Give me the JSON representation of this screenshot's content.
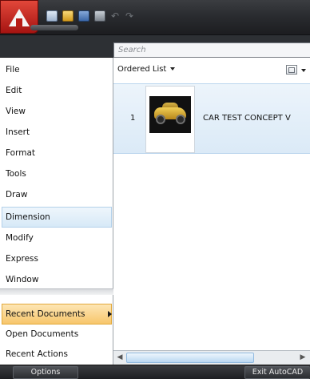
{
  "search": {
    "placeholder": "Search"
  },
  "menu": {
    "items": [
      {
        "label": "File"
      },
      {
        "label": "Edit"
      },
      {
        "label": "View"
      },
      {
        "label": "Insert"
      },
      {
        "label": "Format"
      },
      {
        "label": "Tools"
      },
      {
        "label": "Draw"
      },
      {
        "label": "Dimension"
      },
      {
        "label": "Modify"
      },
      {
        "label": "Express"
      },
      {
        "label": "Window"
      }
    ],
    "lower_items": [
      {
        "label": "Recent Documents"
      },
      {
        "label": "Open Documents"
      },
      {
        "label": "Recent Actions"
      }
    ]
  },
  "list": {
    "sort_label": "Ordered List",
    "documents": [
      {
        "index": "1",
        "name": "CAR TEST CONCEPT V"
      }
    ]
  },
  "footer": {
    "options_label": "Options",
    "exit_label": "Exit AutoCAD"
  },
  "colors": {
    "brand_red": "#c51d18",
    "selection_blue": "#d7e9f7",
    "recent_orange": "#f7c66b"
  }
}
